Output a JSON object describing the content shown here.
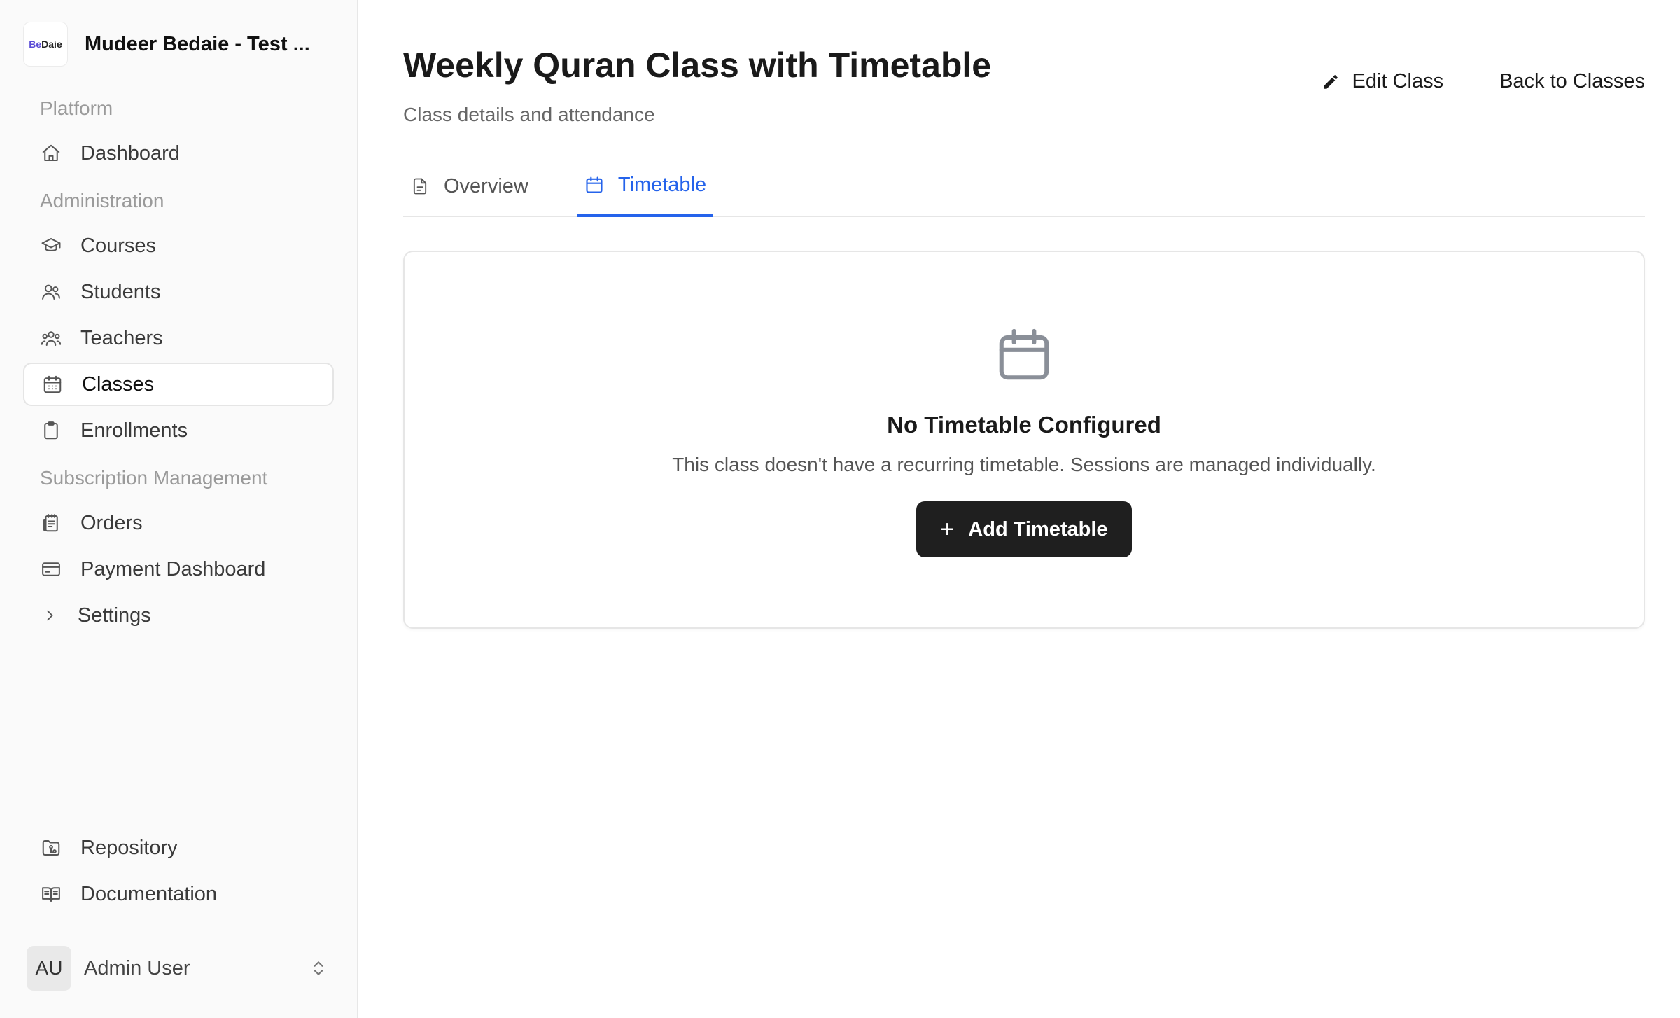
{
  "sidebar": {
    "org": {
      "logo_text_a": "Be",
      "logo_text_b": "Daie",
      "name": "Mudeer Bedaie - Test ..."
    },
    "sections": {
      "platform": "Platform",
      "administration": "Administration",
      "subscription": "Subscription Management"
    },
    "items": {
      "dashboard": "Dashboard",
      "courses": "Courses",
      "students": "Students",
      "teachers": "Teachers",
      "classes": "Classes",
      "enrollments": "Enrollments",
      "orders": "Orders",
      "payment_dashboard": "Payment Dashboard",
      "settings": "Settings",
      "repository": "Repository",
      "documentation": "Documentation"
    },
    "active_item": "classes",
    "user": {
      "initials": "AU",
      "name": "Admin User"
    }
  },
  "header": {
    "title": "Weekly Quran Class with Timetable",
    "subtitle": "Class details and attendance",
    "edit_label": "Edit Class",
    "back_label": "Back to Classes"
  },
  "tabs": [
    {
      "label": "Overview",
      "icon": "document-icon",
      "active": false
    },
    {
      "label": "Timetable",
      "icon": "calendar-icon",
      "active": true
    }
  ],
  "empty_state": {
    "icon": "calendar-icon",
    "title": "No Timetable Configured",
    "description": "This class doesn't have a recurring timetable. Sessions are managed individually.",
    "button_label": "Add Timetable"
  },
  "colors": {
    "accent": "#2563eb",
    "button_bg": "#1f1f1f",
    "sidebar_bg": "#fafafa"
  }
}
